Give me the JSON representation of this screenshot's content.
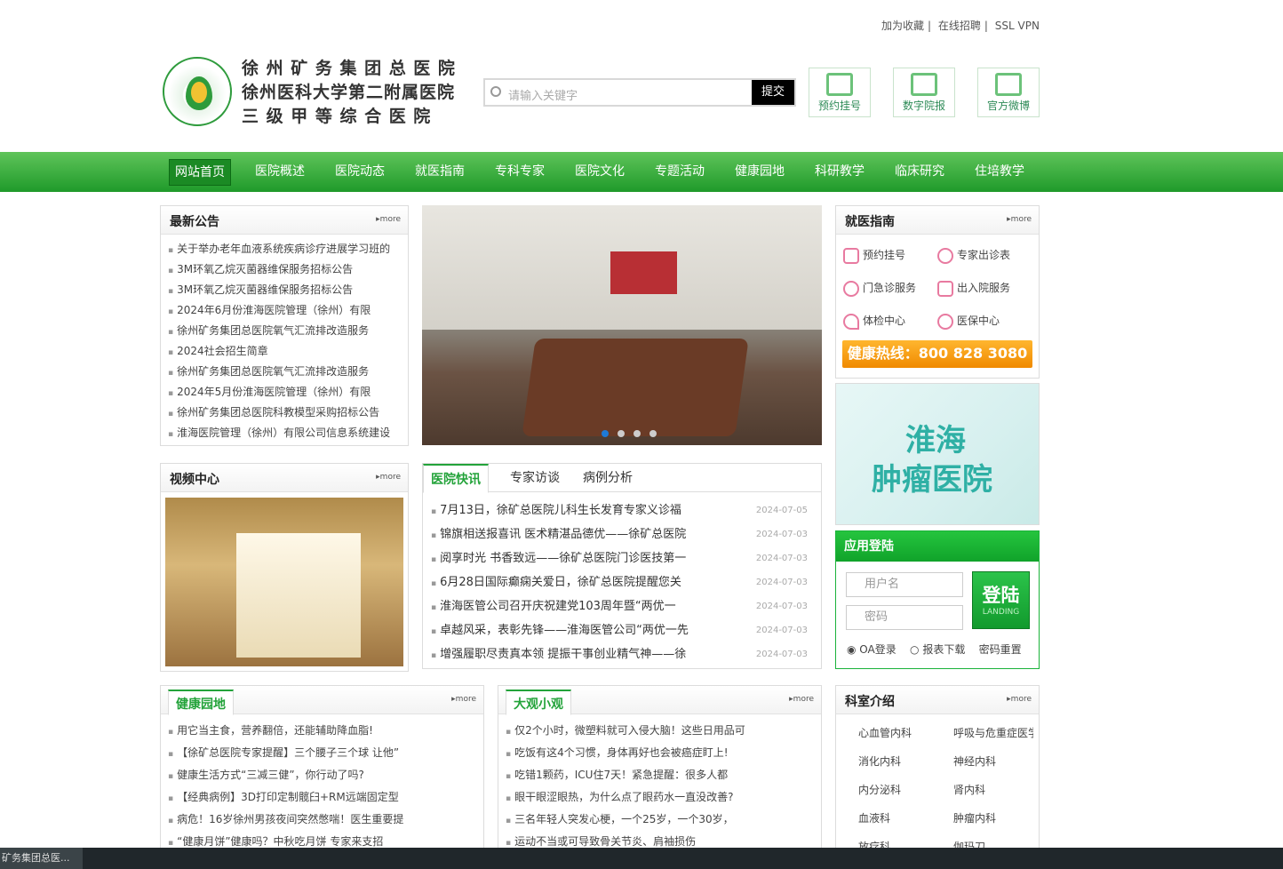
{
  "toplinks": [
    "加为收藏",
    "|",
    "在线招聘",
    "|",
    "SSL VPN"
  ],
  "hospital": {
    "line1": "徐 州 矿 务 集 团 总 医 院",
    "line2": "徐州医科大学第二附属医院",
    "line3": "三 级 甲 等 综 合 医 院"
  },
  "search": {
    "placeholder": "请输入关键字",
    "button": "提交"
  },
  "header_buttons": [
    "预约挂号",
    "数字院报",
    "官方微博"
  ],
  "nav": [
    "网站首页",
    "医院概述",
    "医院动态",
    "就医指南",
    "专科专家",
    "医院文化",
    "专题活动",
    "健康园地",
    "科研教学",
    "临床研究",
    "住培教学"
  ],
  "announcements": {
    "title": "最新公告",
    "more": "more",
    "items": [
      "关于举办老年血液系统疾病诊疗进展学习班的",
      "3M环氧乙烷灭菌器维保服务招标公告",
      "3M环氧乙烷灭菌器维保服务招标公告",
      "2024年6月份淮海医院管理（徐州）有限",
      "徐州矿务集团总医院氧气汇流排改造服务",
      "2024社会招生简章",
      "徐州矿务集团总医院氧气汇流排改造服务",
      "2024年5月份淮海医院管理（徐州）有限",
      "徐州矿务集团总医院科教模型采购招标公告",
      "淮海医院管理（徐州）有限公司信息系统建设"
    ]
  },
  "guide": {
    "title": "就医指南",
    "more": "more",
    "items": [
      "预约挂号",
      "专家出诊表",
      "门急诊服务",
      "出入院服务",
      "体检中心",
      "医保中心"
    ],
    "hotline": "健康热线：800 828 3080"
  },
  "banner": {
    "line1": "淮海",
    "line2": "肿瘤医院"
  },
  "video": {
    "title": "视频中心",
    "more": "more"
  },
  "news_tabs": [
    "医院快讯",
    "专家访谈",
    "病例分析"
  ],
  "news": [
    {
      "title": "7月13日，徐矿总医院儿科生长发育专家义诊福",
      "date": "2024-07-05"
    },
    {
      "title": "锦旗相送报喜讯 医术精湛品德优——徐矿总医院",
      "date": "2024-07-03"
    },
    {
      "title": "阅享时光 书香致远——徐矿总医院门诊医技第一",
      "date": "2024-07-03"
    },
    {
      "title": "6月28日国际癫痫关爱日，徐矿总医院提醒您关",
      "date": "2024-07-03"
    },
    {
      "title": "淮海医管公司召开庆祝建党103周年暨“两优一",
      "date": "2024-07-03"
    },
    {
      "title": "卓越风采，表彰先锋——淮海医管公司“两优一先",
      "date": "2024-07-03"
    },
    {
      "title": "增强履职尽责真本领 提振干事创业精气神——徐",
      "date": "2024-07-03"
    }
  ],
  "login": {
    "title": "应用登陆",
    "user_placeholder": "用户名",
    "pass_placeholder": "密码",
    "button": "登陆",
    "button_sub": "LANDING",
    "opt1": "OA登录",
    "opt2": "报表下载",
    "opt3": "密码重置"
  },
  "health": {
    "title": "健康园地",
    "more": "more",
    "items": [
      "用它当主食，营养翻倍，还能辅助降血脂!",
      "【徐矿总医院专家提醒】三个腰子三个球 让他”",
      "健康生活方式“三减三健”，你行动了吗?",
      "【经典病例】3D打印定制髋臼+RM远端固定型",
      "病危！16岁徐州男孩夜间突然憋喘！医生重要提",
      "“健康月饼”健康吗？中秋吃月饼 专家来支招"
    ]
  },
  "daguan": {
    "title": "大观小观",
    "more": "more",
    "items": [
      "仅2个小时，微塑料就可入侵大脑！这些日用品可",
      "吃饭有这4个习惯，身体再好也会被癌症盯上!",
      "吃错1颗药，ICU住7天！紧急提醒：很多人都",
      "眼干眼涩眼热，为什么点了眼药水一直没改善?",
      "三名年轻人突发心梗，一个25岁，一个30岁，",
      "运动不当或可导致骨关节炎、肩袖损伤"
    ]
  },
  "depts": {
    "title": "科室介绍",
    "more": "more",
    "items": [
      "心血管内科",
      "呼吸与危重症医学",
      "消化内科",
      "神经内科",
      "内分泌科",
      "肾内科",
      "血液科",
      "肿瘤内科",
      "放疗科",
      "伽玛刀"
    ]
  },
  "taskbar": {
    "label": "矿务集团总医..."
  }
}
